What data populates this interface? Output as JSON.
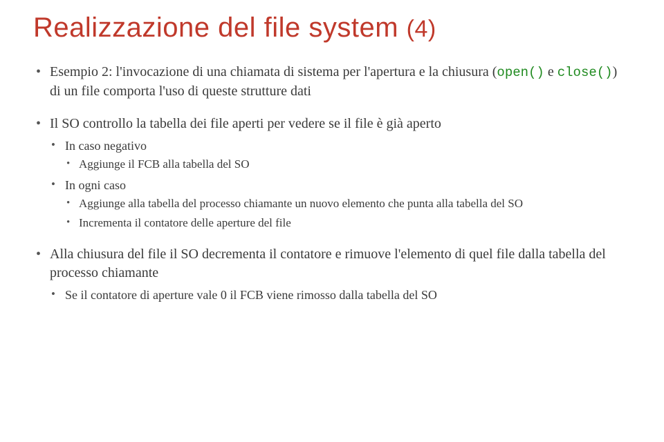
{
  "title_main": "Realizzazione del file system ",
  "title_suffix": "(4)",
  "b1_prefix": "Esempio 2: l'invocazione di una chiamata di sistema per l'apertura e la chiusura (",
  "b1_code1": "open()",
  "b1_mid": " e ",
  "b1_code2": "close()",
  "b1_suffix": ") di un file comporta l'uso di queste strutture dati",
  "b2": "Il SO controllo la tabella dei file aperti per vedere se il file è già aperto",
  "b2_1": "In caso negativo",
  "b2_1_1": "Aggiunge il FCB alla tabella del SO",
  "b2_2": "In ogni caso",
  "b2_2_1": "Aggiunge alla tabella del processo chiamante un nuovo elemento che punta alla tabella del SO",
  "b2_2_2": "Incrementa il contatore delle aperture del file",
  "b3": "Alla chiusura del file il SO decrementa il contatore e rimuove l'elemento di quel file dalla tabella del processo chiamante",
  "b3_1": "Se il contatore di aperture vale 0 il FCB viene rimosso dalla tabella del SO"
}
